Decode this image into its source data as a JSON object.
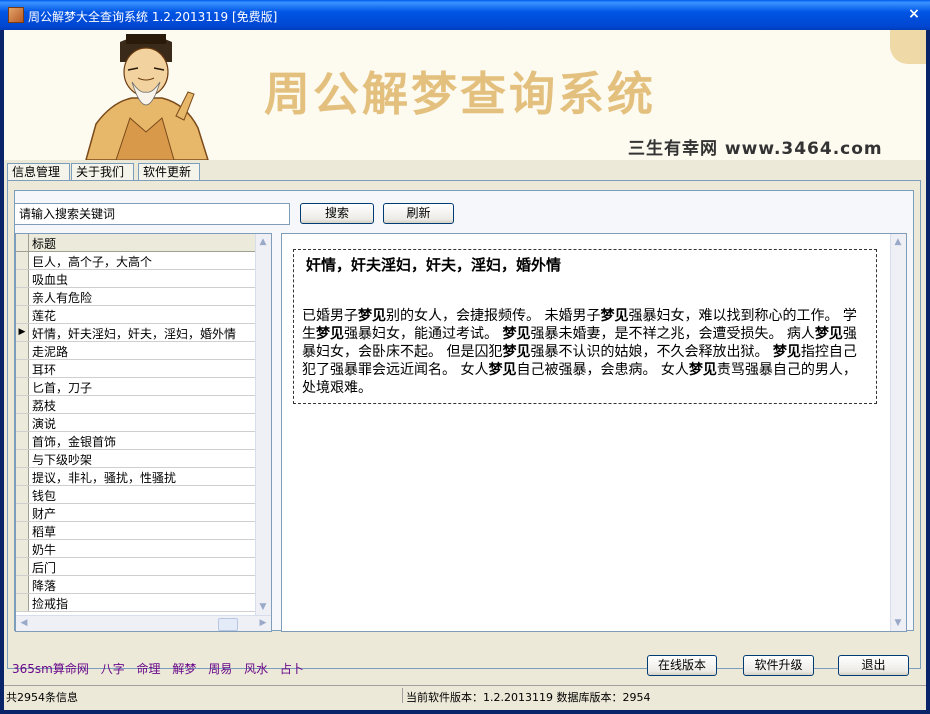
{
  "window": {
    "title": "周公解梦大全查询系统 1.2.2013119 [免费版]",
    "close_label": "×"
  },
  "banner": {
    "title": "周公解梦查询系统",
    "site": "三生有幸网  www.3464.com"
  },
  "tabs": [
    {
      "label": "信息管理"
    },
    {
      "label": "关于我们"
    },
    {
      "label": "软件更新"
    }
  ],
  "search": {
    "value": "请输入搜索关键词",
    "search_label": "搜索",
    "refresh_label": "刷新"
  },
  "list": {
    "header": "标题",
    "selected_marker": "▶",
    "rows": [
      "巨人，高个子，大高个",
      "吸血虫",
      "亲人有危险",
      "莲花",
      "奸情，奸夫淫妇，奸夫，淫妇，婚外情",
      "走泥路",
      "耳环",
      "匕首，刀子",
      "荔枝",
      "演说",
      "首饰，金银首饰",
      "与下级吵架",
      "提议，非礼，骚扰，性骚扰",
      "钱包",
      "财产",
      "稻草",
      "奶牛",
      "后门",
      "降落",
      "捡戒指"
    ],
    "selected_index": 4
  },
  "article": {
    "title": "奸情，奸夫淫妇，奸夫，淫妇，婚外情",
    "keyword": "梦见",
    "segments": [
      "已婚男子",
      "别的女人，会捷报频传。 未婚男子",
      "强暴妇女，难以找到称心的工作。 学生",
      "强暴妇女，能通过考试。 ",
      "强暴未婚妻，是不祥之兆，会遭受损失。 病人",
      "强暴妇女，会卧床不起。 但是囚犯",
      "强暴不认识的姑娘，不久会释放出狱。 ",
      "指控自己犯了强暴罪会远近闻名。 女人",
      "自己被强暴，会患病。 女人",
      "责骂强暴自己的男人，处境艰难。"
    ]
  },
  "buttons": {
    "online_label": "在线版本",
    "upgrade_label": "软件升级",
    "exit_label": "退出"
  },
  "links": [
    "365sm算命网",
    "八字",
    "命理",
    "解梦",
    "周易",
    "风水",
    "占卜"
  ],
  "status": {
    "left": "共2954条信息",
    "right": "当前软件版本：1.2.2013119 数据库版本：2954"
  }
}
